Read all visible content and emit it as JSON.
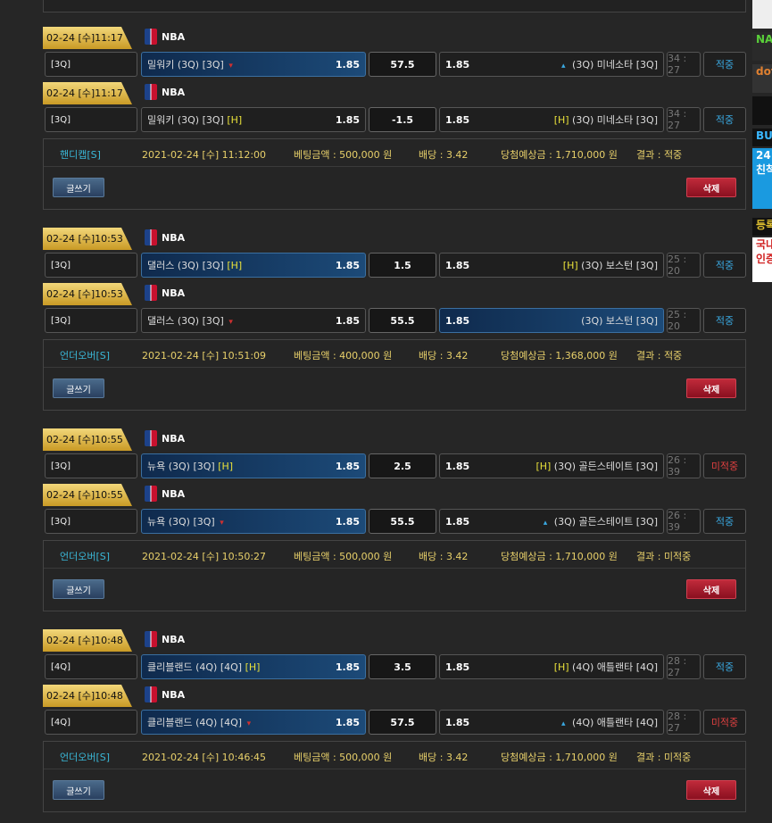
{
  "sidebar": [
    "",
    "NA",
    "dot",
    "",
    "BU",
    "24",
    "친척",
    "등록",
    "국내",
    "인증"
  ],
  "groups": [
    {
      "bets": [
        {
          "date": "02-24 [수]11:17",
          "league": "NBA",
          "quarter": "[3Q]",
          "home": "밀워키 (3Q) [3Q]",
          "home_h": "",
          "home_odds": "1.85",
          "home_sel": true,
          "home_dot": true,
          "mid": "57.5",
          "away": "(3Q) 미네소타 [3Q]",
          "away_h": "",
          "away_odds": "1.85",
          "away_sel": false,
          "away_dot": true,
          "score": "34 : 27",
          "result": "적중",
          "result_class": "hit"
        },
        {
          "date": "02-24 [수]11:17",
          "league": "NBA",
          "quarter": "[3Q]",
          "home": "밀워키 (3Q) [3Q]",
          "home_h": "[H]",
          "home_odds": "1.85",
          "home_sel": false,
          "home_dot": false,
          "mid": "-1.5",
          "away": "(3Q) 미네소타 [3Q]",
          "away_h": "[H]",
          "away_odds": "1.85",
          "away_sel": false,
          "away_dot": false,
          "score": "34 : 27",
          "result": "적중",
          "result_class": "hit"
        }
      ],
      "info": {
        "type": "핸디캡[S]",
        "datetime": "2021-02-24 [수] 11:12:00",
        "amount": "베팅금액 : 500,000 원",
        "odds": "배당 : 3.42",
        "win": "당첨예상금 : 1,710,000 원",
        "result": "결과 : 적중",
        "write": "글쓰기",
        "del": "삭제"
      }
    },
    {
      "bets": [
        {
          "date": "02-24 [수]10:53",
          "league": "NBA",
          "quarter": "[3Q]",
          "home": "댈러스 (3Q) [3Q]",
          "home_h": "[H]",
          "home_odds": "1.85",
          "home_sel": true,
          "home_dot": false,
          "mid": "1.5",
          "away": "(3Q) 보스턴 [3Q]",
          "away_h": "[H]",
          "away_odds": "1.85",
          "away_sel": false,
          "away_dot": false,
          "score": "25 : 20",
          "result": "적중",
          "result_class": "hit"
        },
        {
          "date": "02-24 [수]10:53",
          "league": "NBA",
          "quarter": "[3Q]",
          "home": "댈러스 (3Q) [3Q]",
          "home_h": "",
          "home_odds": "1.85",
          "home_sel": false,
          "home_dot": true,
          "mid": "55.5",
          "away": "(3Q) 보스턴 [3Q]",
          "away_h": "",
          "away_odds": "1.85",
          "away_sel": true,
          "away_dot": false,
          "score": "25 : 20",
          "result": "적중",
          "result_class": "hit"
        }
      ],
      "info": {
        "type": "언더오버[S]",
        "datetime": "2021-02-24 [수] 10:51:09",
        "amount": "베팅금액 : 400,000 원",
        "odds": "배당 : 3.42",
        "win": "당첨예상금 : 1,368,000 원",
        "result": "결과 : 적중",
        "write": "글쓰기",
        "del": "삭제"
      }
    },
    {
      "bets": [
        {
          "date": "02-24 [수]10:55",
          "league": "NBA",
          "quarter": "[3Q]",
          "home": "뉴욕 (3Q) [3Q]",
          "home_h": "[H]",
          "home_odds": "1.85",
          "home_sel": true,
          "home_dot": false,
          "mid": "2.5",
          "away": "(3Q) 골든스테이트 [3Q]",
          "away_h": "[H]",
          "away_odds": "1.85",
          "away_sel": false,
          "away_dot": false,
          "score": "26 : 39",
          "result": "미적중",
          "result_class": "miss"
        },
        {
          "date": "02-24 [수]10:55",
          "league": "NBA",
          "quarter": "[3Q]",
          "home": "뉴욕 (3Q) [3Q]",
          "home_h": "",
          "home_odds": "1.85",
          "home_sel": true,
          "home_dot": true,
          "mid": "55.5",
          "away": "(3Q) 골든스테이트 [3Q]",
          "away_h": "",
          "away_odds": "1.85",
          "away_sel": false,
          "away_dot": true,
          "score": "26 : 39",
          "result": "적중",
          "result_class": "hit"
        }
      ],
      "info": {
        "type": "언더오버[S]",
        "datetime": "2021-02-24 [수] 10:50:27",
        "amount": "베팅금액 : 500,000 원",
        "odds": "배당 : 3.42",
        "win": "당첨예상금 : 1,710,000 원",
        "result": "결과 : 미적중",
        "write": "글쓰기",
        "del": "삭제"
      }
    },
    {
      "bets": [
        {
          "date": "02-24 [수]10:48",
          "league": "NBA",
          "quarter": "[4Q]",
          "home": "클리블랜드 (4Q) [4Q]",
          "home_h": "[H]",
          "home_odds": "1.85",
          "home_sel": true,
          "home_dot": false,
          "mid": "3.5",
          "away": "(4Q) 애틀랜타 [4Q]",
          "away_h": "[H]",
          "away_odds": "1.85",
          "away_sel": false,
          "away_dot": false,
          "score": "28 : 27",
          "result": "적중",
          "result_class": "hit"
        },
        {
          "date": "02-24 [수]10:48",
          "league": "NBA",
          "quarter": "[4Q]",
          "home": "클리블랜드 (4Q) [4Q]",
          "home_h": "",
          "home_odds": "1.85",
          "home_sel": true,
          "home_dot": true,
          "mid": "57.5",
          "away": "(4Q) 애틀랜타 [4Q]",
          "away_h": "",
          "away_odds": "1.85",
          "away_sel": false,
          "away_dot": true,
          "score": "28 : 27",
          "result": "미적중",
          "result_class": "miss"
        }
      ],
      "info": {
        "type": "언더오버[S]",
        "datetime": "2021-02-24 [수] 10:46:45",
        "amount": "베팅금액 : 500,000 원",
        "odds": "배당 : 3.42",
        "win": "당첨예상금 : 1,710,000 원",
        "result": "결과 : 미적중",
        "write": "글쓰기",
        "del": "삭제"
      }
    }
  ]
}
